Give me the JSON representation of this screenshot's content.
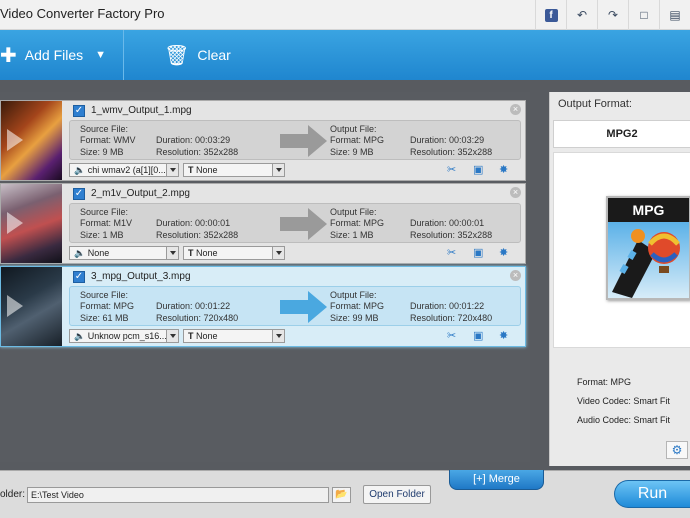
{
  "app": {
    "title": "Video Converter Factory Pro"
  },
  "titlebar_icons": [
    "facebook-icon",
    "undo-icon",
    "redo-icon",
    "chat-icon",
    "register-icon"
  ],
  "toolbar": {
    "add_files": "Add Files",
    "clear": "Clear"
  },
  "labels": {
    "source_file": "Source File:",
    "output_file": "Output File:",
    "format": "Format:",
    "size": "Size:",
    "duration": "Duration:",
    "resolution": "Resolution:"
  },
  "files": [
    {
      "name": "1_wmv_Output_1.mpg",
      "checked": true,
      "selected": false,
      "src": {
        "format": "WMV",
        "size": "9 MB",
        "duration": "00:03:29",
        "resolution": "352x288"
      },
      "out": {
        "format": "MPG",
        "size": "9 MB",
        "duration": "00:03:29",
        "resolution": "352x288"
      },
      "audio": "chi wmav2 (a[1][0...",
      "subtitle": "None"
    },
    {
      "name": "2_m1v_Output_2.mpg",
      "checked": true,
      "selected": false,
      "src": {
        "format": "M1V",
        "size": "1 MB",
        "duration": "00:00:01",
        "resolution": "352x288"
      },
      "out": {
        "format": "MPG",
        "size": "1 MB",
        "duration": "00:00:01",
        "resolution": "352x288"
      },
      "audio": "None",
      "subtitle": "None"
    },
    {
      "name": "3_mpg_Output_3.mpg",
      "checked": true,
      "selected": true,
      "src": {
        "format": "MPG",
        "size": "61 MB",
        "duration": "00:01:22",
        "resolution": "720x480"
      },
      "out": {
        "format": "MPG",
        "size": "99 MB",
        "duration": "00:01:22",
        "resolution": "720x480"
      },
      "audio": "Unknow pcm_s16...",
      "subtitle": "None"
    }
  ],
  "right_panel": {
    "label": "Output Format:",
    "format_name": "MPG2",
    "icon_text": "MPG",
    "format_prop": "Format: MPG",
    "video_codec": "Video Codec: Smart Fit",
    "audio_codec": "Audio Codec: Smart Fit"
  },
  "bottom": {
    "merge": "Merge",
    "folder_label": "older:",
    "folder_value": "E:\\Test Video",
    "open_folder": "Open Folder",
    "run": "Run"
  },
  "colors": {
    "accent": "#2089d2",
    "selected_row": "#d8edf7",
    "arrow_active": "#4aa8e0",
    "arrow_idle": "#9a9a9a"
  }
}
